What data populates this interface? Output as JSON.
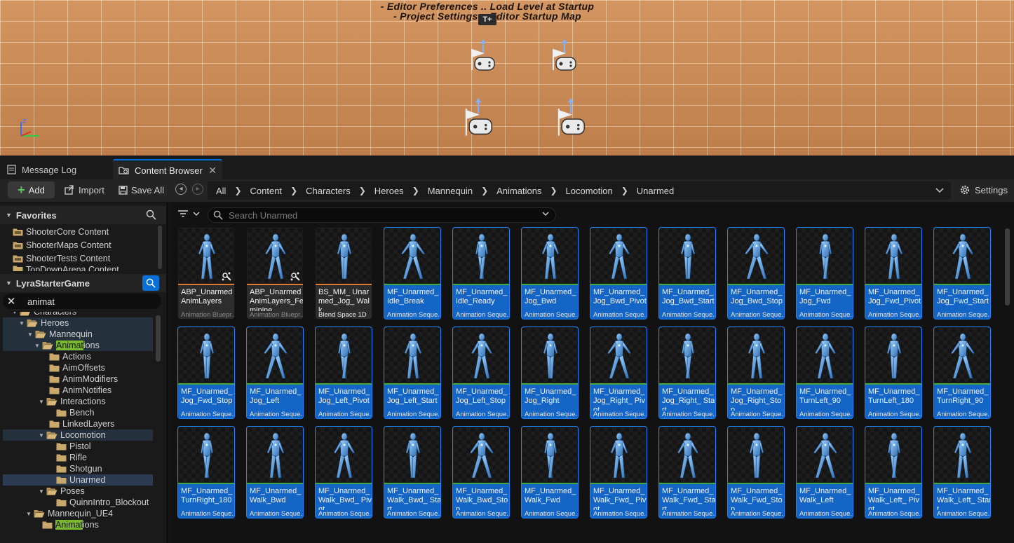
{
  "viewport": {
    "line1": "- Editor Preferences .. Load Level at Startup",
    "line2": "- Project Settings .. Editor Startup Map",
    "tag": "T+",
    "axis_z": "Z",
    "colors": {
      "floor": "#c98a55",
      "grid": "#ffebd2"
    }
  },
  "tabs": {
    "message_log": "Message Log",
    "content_browser": "Content Browser"
  },
  "toolbar": {
    "add_label": "Add",
    "import_label": "Import",
    "save_all_label": "Save All",
    "settings_label": "Settings"
  },
  "breadcrumb": [
    "All",
    "Content",
    "Characters",
    "Heroes",
    "Mannequin",
    "Animations",
    "Locomotion",
    "Unarmed"
  ],
  "favorites": {
    "title": "Favorites",
    "items": [
      "ShooterCore Content",
      "ShooterMaps Content",
      "ShooterTests Content",
      "TopDownArena Content"
    ]
  },
  "project": {
    "title": "LyraStarterGame",
    "filter_text": "animat"
  },
  "tree": [
    {
      "label": "Characters"
    },
    {
      "label": "Heroes"
    },
    {
      "label": "Mannequin"
    },
    {
      "label_pre": "",
      "label_match": "Animat",
      "label_post": "ions"
    },
    {
      "label": "Actions"
    },
    {
      "label": "AimOffsets"
    },
    {
      "label": "AnimModifiers"
    },
    {
      "label": "AnimNotifies"
    },
    {
      "label": "Interactions"
    },
    {
      "label": "Bench"
    },
    {
      "label": "LinkedLayers"
    },
    {
      "label": "Locomotion"
    },
    {
      "label": "Pistol"
    },
    {
      "label": "Rifle"
    },
    {
      "label": "Shotgun"
    },
    {
      "label": "Unarmed"
    },
    {
      "label": "Poses"
    },
    {
      "label": "QuinnIntro_Blockout"
    },
    {
      "label": "Mannequin_UE4"
    },
    {
      "label_pre": "",
      "label_match": "Animat",
      "label_post": "ions"
    }
  ],
  "search": {
    "placeholder": "Search Unarmed"
  },
  "assets": [
    {
      "name": "ABP_Unarmed AnimLayers",
      "type": "Animation Bluepr...",
      "kind": "blueprint"
    },
    {
      "name": "ABP_Unarmed AnimLayers_Feminine",
      "type": "Animation Bluepr...",
      "kind": "blueprint"
    },
    {
      "name": "BS_MM_ Unarmed_Jog_ Walk",
      "type": "Blend Space 1D",
      "kind": "blend"
    },
    {
      "name": "MF_Unarmed_ Idle_Break",
      "type": "Animation Seque...",
      "kind": "seq"
    },
    {
      "name": "MF_Unarmed_ Idle_Ready",
      "type": "Animation Seque...",
      "kind": "seq"
    },
    {
      "name": "MF_Unarmed_ Jog_Bwd",
      "type": "Animation Seque...",
      "kind": "seq"
    },
    {
      "name": "MF_Unarmed_ Jog_Bwd_Pivot",
      "type": "Animation Seque...",
      "kind": "seq"
    },
    {
      "name": "MF_Unarmed_ Jog_Bwd_Start",
      "type": "Animation Seque...",
      "kind": "seq"
    },
    {
      "name": "MF_Unarmed_ Jog_Bwd_Stop",
      "type": "Animation Seque...",
      "kind": "seq"
    },
    {
      "name": "MF_Unarmed_ Jog_Fwd",
      "type": "Animation Seque...",
      "kind": "seq"
    },
    {
      "name": "MF_Unarmed_ Jog_Fwd_Pivot",
      "type": "Animation Seque...",
      "kind": "seq"
    },
    {
      "name": "MF_Unarmed_ Jog_Fwd_Start",
      "type": "Animation Seque...",
      "kind": "seq"
    },
    {
      "name": "MF_Unarmed_ Jog_Fwd_Stop",
      "type": "Animation Seque...",
      "kind": "seq"
    },
    {
      "name": "MF_Unarmed_ Jog_Left",
      "type": "Animation Seque...",
      "kind": "seq"
    },
    {
      "name": "MF_Unarmed_ Jog_Left_Pivot",
      "type": "Animation Seque...",
      "kind": "seq"
    },
    {
      "name": "MF_Unarmed_ Jog_Left_Start",
      "type": "Animation Seque...",
      "kind": "seq"
    },
    {
      "name": "MF_Unarmed_ Jog_Left_Stop",
      "type": "Animation Seque...",
      "kind": "seq"
    },
    {
      "name": "MF_Unarmed_ Jog_Right",
      "type": "Animation Seque...",
      "kind": "seq"
    },
    {
      "name": "MF_Unarmed_ Jog_Right_ Pivot",
      "type": "Animation Seque...",
      "kind": "seq"
    },
    {
      "name": "MF_Unarmed_ Jog_Right_ Start",
      "type": "Animation Seque...",
      "kind": "seq"
    },
    {
      "name": "MF_Unarmed_ Jog_Right_Stop",
      "type": "Animation Seque...",
      "kind": "seq"
    },
    {
      "name": "MF_Unarmed_ TurnLeft_90",
      "type": "Animation Seque...",
      "kind": "seq"
    },
    {
      "name": "MF_Unarmed_ TurnLeft_180",
      "type": "Animation Seque...",
      "kind": "seq"
    },
    {
      "name": "MF_Unarmed_ TurnRight_90",
      "type": "Animation Seque...",
      "kind": "seq"
    },
    {
      "name": "MF_Unarmed_ TurnRight_180",
      "type": "Animation Seque...",
      "kind": "seq"
    },
    {
      "name": "MF_Unarmed_ Walk_Bwd",
      "type": "Animation Seque...",
      "kind": "seq"
    },
    {
      "name": "MF_Unarmed_ Walk_Bwd_ Pivot",
      "type": "Animation Seque...",
      "kind": "seq"
    },
    {
      "name": "MF_Unarmed_ Walk_Bwd_ Start",
      "type": "Animation Seque...",
      "kind": "seq"
    },
    {
      "name": "MF_Unarmed_ Walk_Bwd_Stop",
      "type": "Animation Seque...",
      "kind": "seq"
    },
    {
      "name": "MF_Unarmed_ Walk_Fwd",
      "type": "Animation Seque...",
      "kind": "seq"
    },
    {
      "name": "MF_Unarmed_ Walk_Fwd_ Pivot",
      "type": "Animation Seque...",
      "kind": "seq"
    },
    {
      "name": "MF_Unarmed_ Walk_Fwd_ Start",
      "type": "Animation Seque...",
      "kind": "seq"
    },
    {
      "name": "MF_Unarmed_ Walk_Fwd_Stop",
      "type": "Animation Seque...",
      "kind": "seq"
    },
    {
      "name": "MF_Unarmed_ Walk_Left",
      "type": "Animation Seque...",
      "kind": "seq"
    },
    {
      "name": "MF_Unarmed_ Walk_Left_ Pivot",
      "type": "Animation Seque...",
      "kind": "seq"
    },
    {
      "name": "MF_Unarmed_ Walk_Left_ Start",
      "type": "Animation Seque...",
      "kind": "seq"
    }
  ],
  "colors": {
    "accent": "#0070e0",
    "selection_tile": "#1565c6",
    "blueprint_strip": "#e07a2c",
    "sequence_strip": "#3fa93f",
    "filter_match": "#7ab82e",
    "add_plus": "#5cc45c"
  }
}
